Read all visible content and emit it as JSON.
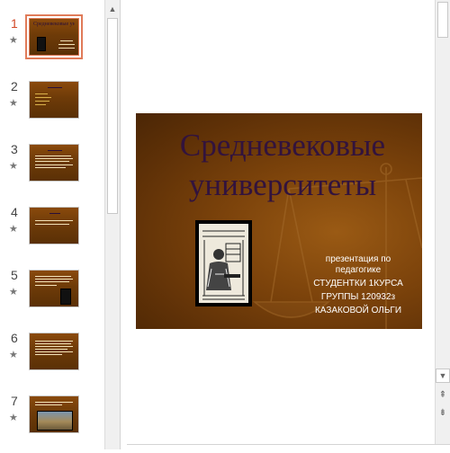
{
  "slides_panel": {
    "slides": [
      {
        "number": "1",
        "title": "Средневековые университеты",
        "active": true
      },
      {
        "number": "2",
        "active": false
      },
      {
        "number": "3",
        "active": false
      },
      {
        "number": "4",
        "active": false
      },
      {
        "number": "5",
        "active": false
      },
      {
        "number": "6",
        "active": false
      },
      {
        "number": "7",
        "active": false
      }
    ],
    "star_glyph": "★"
  },
  "main_slide": {
    "title_line1": "Средневековые",
    "title_line2": "университеты",
    "subtitle_line1": "презентация по",
    "subtitle_line2": "педагогике",
    "subtitle_line3": "СТУДЕНТКИ 1КУРСА",
    "subtitle_line4": "ГРУППЫ  120932з",
    "subtitle_line5": "КАЗАКОВОЙ ОЛЬГИ"
  },
  "colors": {
    "slide_background": "#7c430b",
    "title_text": "#32133d",
    "active_thumb_accent": "#d24726"
  },
  "icons": [
    "star-icon",
    "scroll-up-arrow-icon",
    "scroll-down-arrow-icon",
    "previous-slide-icon",
    "next-slide-icon"
  ]
}
